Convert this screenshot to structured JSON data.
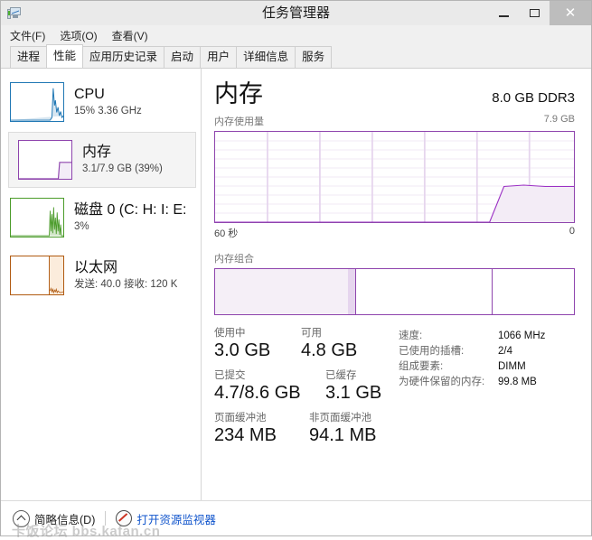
{
  "window": {
    "title": "任务管理器",
    "icon": "taskmanager-icon",
    "buttons": {
      "minimize": "–",
      "maximize": "□",
      "close": "✕"
    }
  },
  "menu": {
    "items": [
      {
        "label": "文件(F)"
      },
      {
        "label": "选项(O)"
      },
      {
        "label": "查看(V)"
      }
    ]
  },
  "tabs": [
    {
      "label": "进程",
      "active": false
    },
    {
      "label": "性能",
      "active": true
    },
    {
      "label": "应用历史记录",
      "active": false
    },
    {
      "label": "启动",
      "active": false
    },
    {
      "label": "用户",
      "active": false
    },
    {
      "label": "详细信息",
      "active": false
    },
    {
      "label": "服务",
      "active": false
    }
  ],
  "sidebar": {
    "items": [
      {
        "name": "cpu",
        "title": "CPU",
        "subtitle": "15%  3.36 GHz",
        "color": "#1f77b4",
        "fill": "rgba(31,119,180,0.22)",
        "selected": false
      },
      {
        "name": "memory",
        "title": "内存",
        "subtitle": "3.1/7.9 GB (39%)",
        "color": "#8e44ad",
        "fill": "rgba(142,68,173,0.14)",
        "selected": true
      },
      {
        "name": "disk-0",
        "title": "磁盘 0 (C: H: I: E:",
        "subtitle": "3%",
        "color": "#4a9b29",
        "fill": "rgba(74,155,41,0.25)",
        "selected": false
      },
      {
        "name": "ethernet",
        "title": "以太网",
        "subtitle": "发送: 40.0 接收: 120 K",
        "color": "#b05a10",
        "fill": "rgba(232,150,60,0.20)",
        "selected": false
      }
    ]
  },
  "main": {
    "title": "内存",
    "subtitle": "8.0 GB DDR3",
    "graph": {
      "label_left": "内存使用量",
      "label_right": "7.9 GB",
      "axis_left": "60 秒",
      "axis_right": "0",
      "line_color": "#8e44ad",
      "fill_color": "#f3ecf6",
      "grid_color": "#e6d5ee",
      "grid_rows": 10,
      "grid_cols": 7
    },
    "composition": {
      "label": "内存组合",
      "border_color": "#8e44ad",
      "segments": [
        {
          "name": "in-use",
          "width_pct": 37.0,
          "color": "#f5eff7"
        },
        {
          "name": "modified",
          "width_pct": 2.0,
          "color": "#e6d5ee"
        },
        {
          "name": "standby",
          "width_pct": 38.0,
          "color": "#ffffff"
        },
        {
          "name": "free",
          "width_pct": 23.0,
          "color": "#ffffff"
        }
      ]
    },
    "stats_left": [
      [
        {
          "label": "使用中",
          "value": "3.0 GB"
        },
        {
          "label": "可用",
          "value": "4.8 GB"
        }
      ],
      [
        {
          "label": "已提交",
          "value": "4.7/8.6 GB"
        },
        {
          "label": "已缓存",
          "value": "3.1 GB"
        }
      ],
      [
        {
          "label": "页面缓冲池",
          "value": "234 MB"
        },
        {
          "label": "非页面缓冲池",
          "value": "94.1 MB"
        }
      ]
    ],
    "stats_right": [
      {
        "key": "速度:",
        "value": "1066 MHz"
      },
      {
        "key": "已使用的插槽:",
        "value": "2/4"
      },
      {
        "key": "组成要素:",
        "value": "DIMM"
      },
      {
        "key": "为硬件保留的内存:",
        "value": "99.8 MB"
      }
    ]
  },
  "footer": {
    "fewer_details": "简略信息(D)",
    "resource_monitor": "打开资源监视器",
    "watermark": "卡饭论坛 bbs.kafan.cn"
  },
  "chart_data": {
    "type": "area",
    "title": "内存使用量",
    "ylabel": "",
    "xlabel": "",
    "ylim": [
      0,
      7.9
    ],
    "y_max_label": "7.9 GB",
    "x_axis_labels": [
      "60 秒",
      "0"
    ],
    "grid": true,
    "series": [
      {
        "name": "内存使用量",
        "x": [
          0,
          10,
          20,
          30,
          40,
          50,
          55,
          62,
          74,
          77,
          80,
          86,
          92,
          100
        ],
        "values": [
          0,
          0,
          0,
          0,
          0,
          0,
          0,
          0,
          0,
          1.6,
          3.1,
          3.15,
          3.1,
          3.1
        ]
      }
    ]
  }
}
